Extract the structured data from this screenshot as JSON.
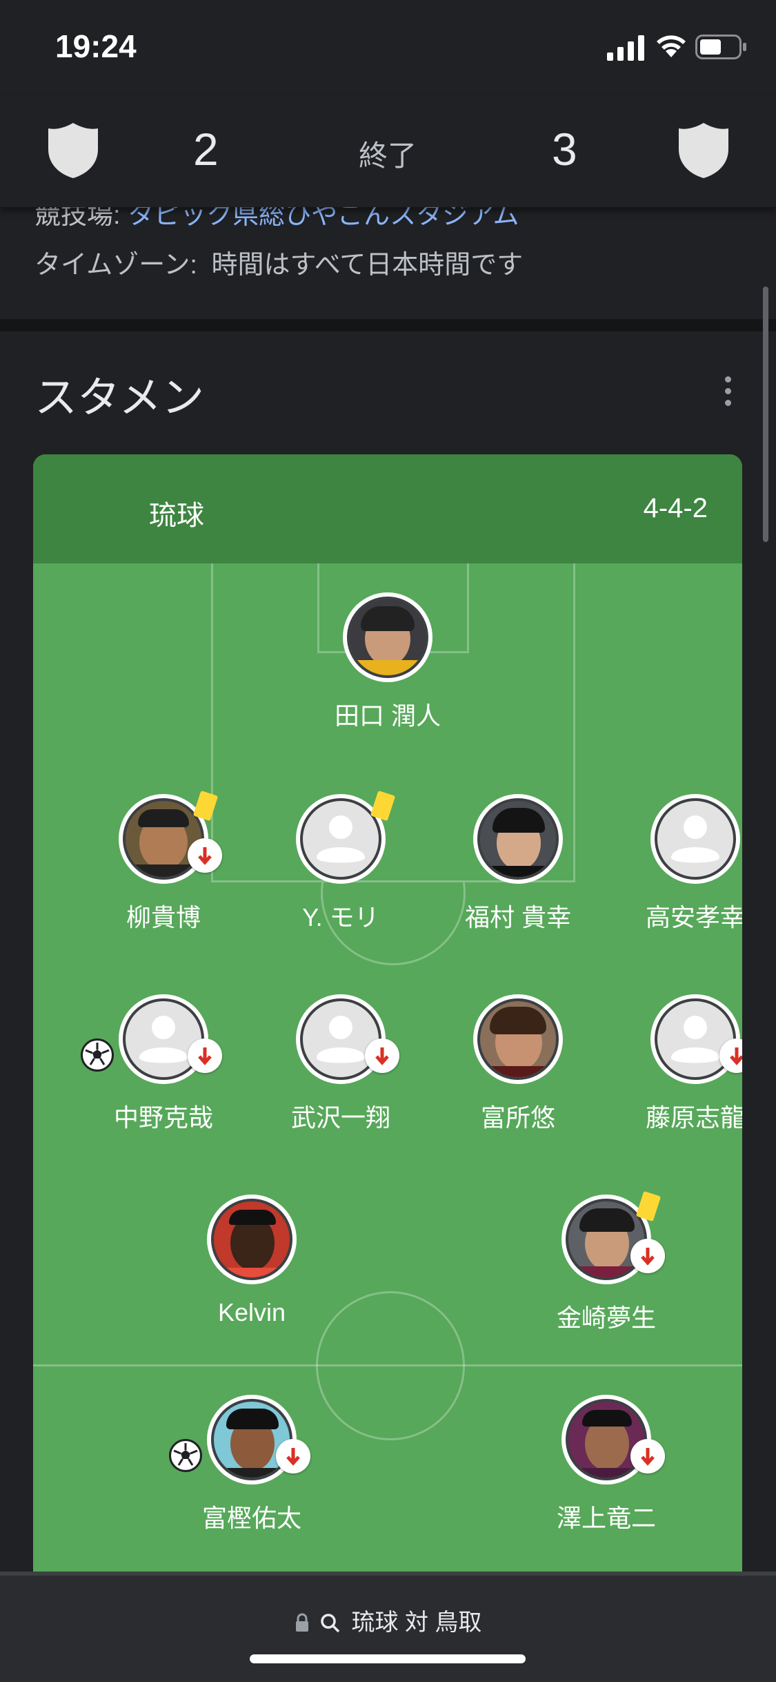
{
  "status_bar": {
    "time": "19:24"
  },
  "score_header": {
    "home_score": "2",
    "status": "終了",
    "away_score": "3",
    "home_icon": "shield-icon",
    "away_icon": "shield-icon"
  },
  "info": {
    "venue_label": "競技場:",
    "venue_value": "タピック県総ひやごんスタジアム",
    "timezone_label": "タイムゾーン:",
    "timezone_value": "時間はすべて日本時間です"
  },
  "lineup": {
    "title": "スタメン",
    "team": "琉球",
    "formation": "4-4-2",
    "players": [
      {
        "name": "田口 潤人",
        "photo": "photo",
        "sub": false,
        "card": false,
        "goal": false
      },
      {
        "name": "柳貴博",
        "photo": "photo",
        "sub": true,
        "card": true,
        "goal": false
      },
      {
        "name": "Y. モリ",
        "photo": "generic",
        "sub": false,
        "card": true,
        "goal": false
      },
      {
        "name": "福村 貴幸",
        "photo": "photo",
        "sub": false,
        "card": false,
        "goal": false
      },
      {
        "name": "高安孝幸",
        "photo": "generic",
        "sub": false,
        "card": false,
        "goal": false
      },
      {
        "name": "中野克哉",
        "photo": "generic",
        "sub": true,
        "card": false,
        "goal": true
      },
      {
        "name": "武沢一翔",
        "photo": "generic",
        "sub": true,
        "card": false,
        "goal": false
      },
      {
        "name": "富所悠",
        "photo": "photo",
        "sub": false,
        "card": false,
        "goal": false
      },
      {
        "name": "藤原志龍",
        "photo": "generic",
        "sub": true,
        "card": false,
        "goal": false
      },
      {
        "name": "Kelvin",
        "photo": "photo",
        "sub": false,
        "card": false,
        "goal": false
      },
      {
        "name": "金崎夢生",
        "photo": "photo",
        "sub": true,
        "card": true,
        "goal": false
      },
      {
        "name": "富樫佑太",
        "photo": "photo",
        "sub": true,
        "card": false,
        "goal": true
      },
      {
        "name": "澤上竜二",
        "photo": "photo",
        "sub": true,
        "card": false,
        "goal": false
      }
    ]
  },
  "bottom_bar": {
    "url_text": "琉球 対 鳥取"
  },
  "colors": {
    "pitch": "#57a85a",
    "pitch_header": "#3d8541",
    "link": "#8ab4f8",
    "card": "#fdd835",
    "sub_arrow": "#d93025"
  }
}
